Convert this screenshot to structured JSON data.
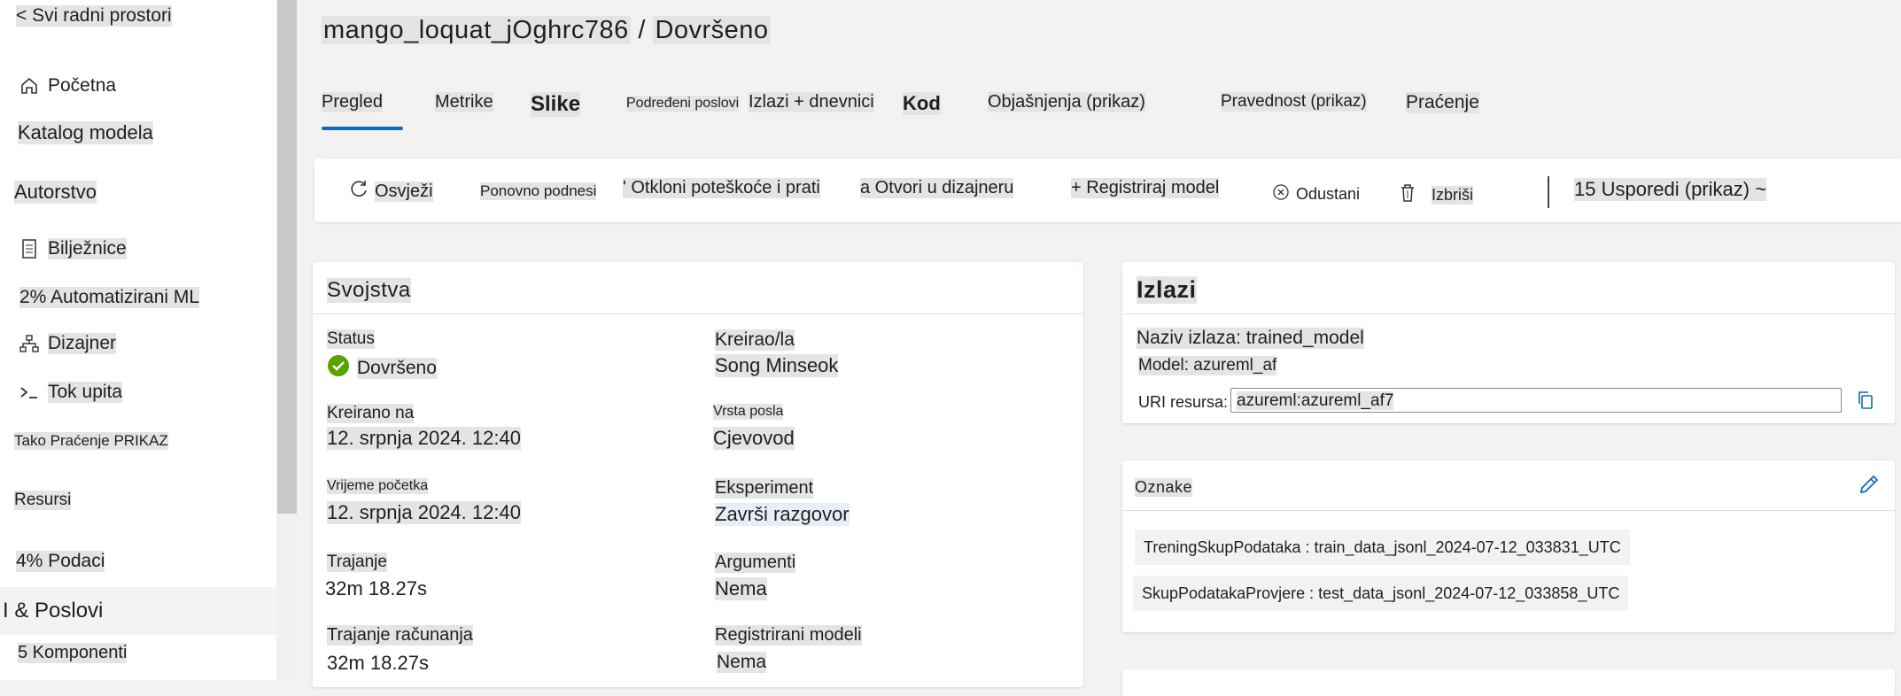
{
  "sidebar": {
    "back": "< Svi radni prostori",
    "items": [
      {
        "label": "Početna",
        "icon": "home-icon"
      },
      {
        "label": "Katalog modela",
        "icon": ""
      },
      {
        "label": "Autorstvo",
        "icon": ""
      },
      {
        "label": "Bilježnice",
        "icon": "notebook-icon"
      },
      {
        "label": "2% Automatizirani ML",
        "icon": ""
      },
      {
        "label": "Dizajner",
        "icon": "designer-icon"
      },
      {
        "label": "Tok upita",
        "icon": "prompt-flow-icon"
      },
      {
        "label": "Tako Praćenje PRIKAZ",
        "icon": ""
      },
      {
        "label": "Resursi",
        "icon": ""
      },
      {
        "label": "4% Podaci",
        "icon": ""
      },
      {
        "label": "I & Poslovi",
        "icon": ""
      },
      {
        "label": "5 Komponenti",
        "icon": ""
      }
    ]
  },
  "header": {
    "run_name": "mango_loquat_jOghrc786",
    "separator": "/",
    "status": "Dovršeno"
  },
  "tabs": [
    "Pregled",
    "Metrike",
    "Slike",
    "Podređeni poslovi",
    "Izlazi + dnevnici",
    "Kod",
    "Objašnjenja (prikaz)",
    "Pravednost (prikaz)",
    "Praćenje"
  ],
  "toolbar": {
    "refresh": "Osvježi",
    "resubmit": "Ponovno podnesi",
    "debug": "' Otkloni poteškoće i prati",
    "open_designer": "a Otvori u dizajneru",
    "register": "+ Registriraj model",
    "cancel": "Odustani",
    "delete": "Izbriši",
    "compare": "15 Usporedi (prikaz) ~"
  },
  "properties": {
    "title": "Svojstva",
    "status_label": "Status",
    "status_value": "Dovršeno",
    "created_by_label": "Kreirao/la",
    "created_by_value": "Song Minseok",
    "created_on_label": "Kreirano na",
    "created_on_value": "12. srpnja 2024. 12:40",
    "job_type_label": "Vrsta posla",
    "job_type_value": "Cjevovod",
    "start_time_label": "Vrijeme početka",
    "start_time_value": "12. srpnja 2024. 12:40",
    "experiment_label": "Eksperiment",
    "experiment_value": "Završi razgovor",
    "duration_label": "Trajanje",
    "duration_value": "32m 18.27s",
    "arguments_label": "Argumenti",
    "arguments_value": "Nema",
    "compute_duration_label": "Trajanje računanja",
    "compute_duration_value": "32m 18.27s",
    "registered_models_label": "Registrirani modeli",
    "registered_models_value": "Nema"
  },
  "outputs": {
    "title": "Izlazi",
    "output_name": "Naziv izlaza: trained_model",
    "model": "Model: azureml_af",
    "uri_label": "URI resursa:",
    "uri_value": "azureml:azureml_af7"
  },
  "tags": {
    "title": "Oznake",
    "items": [
      "TreningSkupPodataka : train_data_jsonl_2024-07-12_033831_UTC",
      "SkupPodatakaProvjere : test_data_jsonl_2024-07-12_033858_UTC"
    ]
  },
  "colors": {
    "accent": "#0f6cbd",
    "success": "#57a300"
  }
}
